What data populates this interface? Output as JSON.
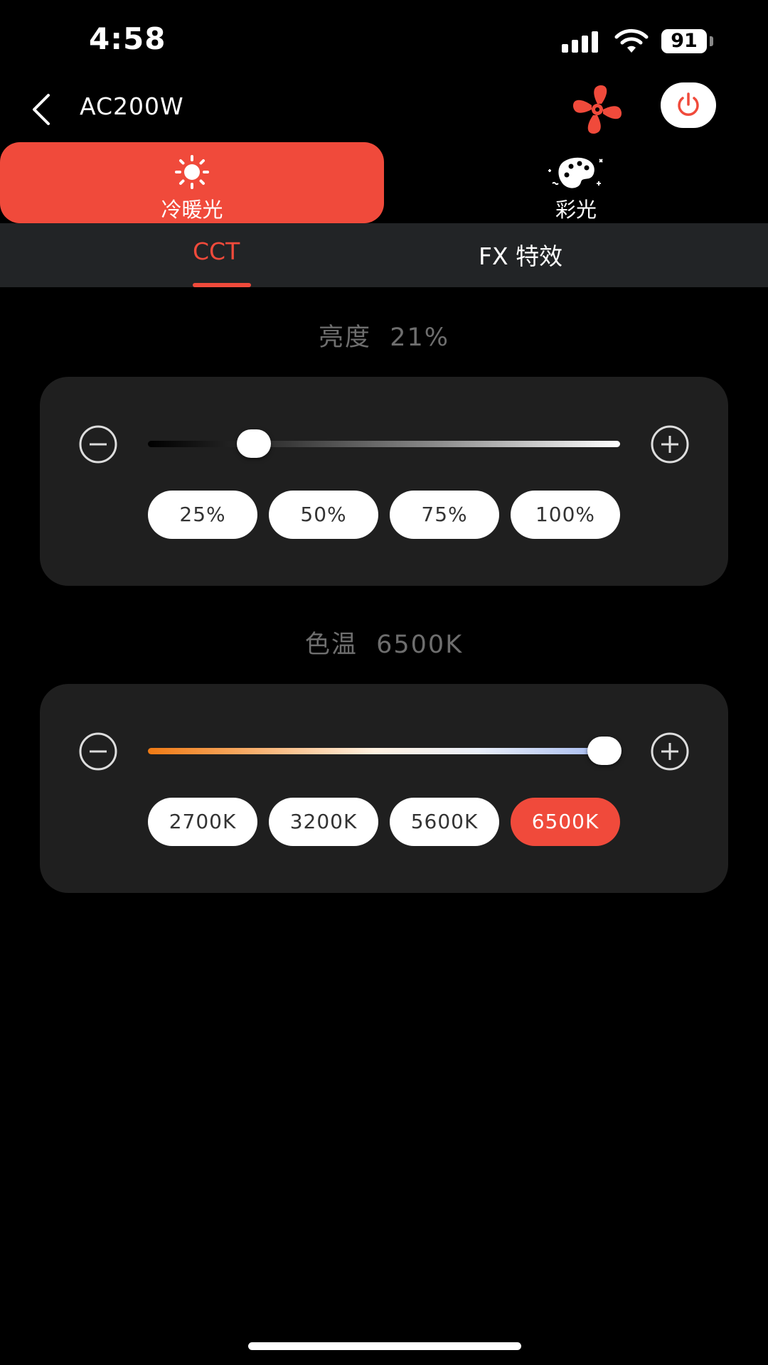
{
  "status": {
    "time": "4:58",
    "battery": "91"
  },
  "header": {
    "title": "AC200W",
    "back_icon": "chevron-left-icon",
    "fan_icon": "fan-icon",
    "power_icon": "power-icon",
    "accent_color": "#f04a3b"
  },
  "mode_tabs": [
    {
      "label": "冷暖光",
      "icon": "sun-icon",
      "active": true
    },
    {
      "label": "彩光",
      "icon": "palette-icon",
      "active": false
    }
  ],
  "sub_tabs": [
    {
      "label": "CCT",
      "active": true
    },
    {
      "label": "FX 特效",
      "active": false
    }
  ],
  "brightness": {
    "label": "亮度",
    "value_text": "21%",
    "value": 21,
    "presets": [
      "25%",
      "50%",
      "75%",
      "100%"
    ]
  },
  "color_temp": {
    "label": "色温",
    "value_text": "6500K",
    "value": 6500,
    "min": 2700,
    "max": 6500,
    "presets": [
      "2700K",
      "3200K",
      "5600K",
      "6500K"
    ],
    "active_preset": "6500K"
  }
}
